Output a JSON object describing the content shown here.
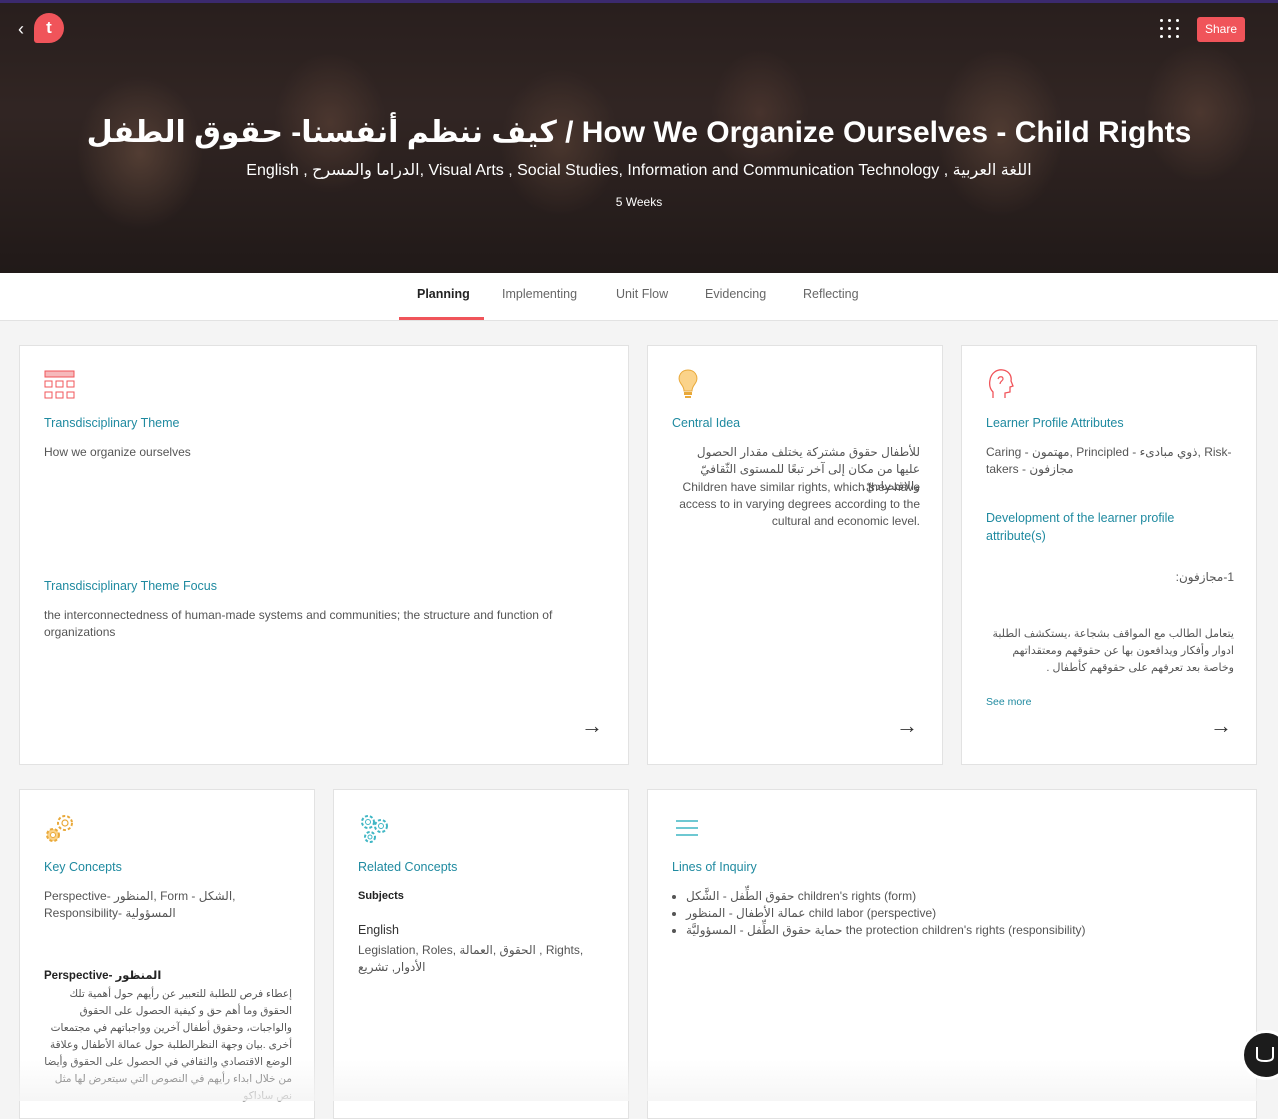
{
  "header": {
    "title": "كيف ننظم أنفسنا- حقوق الطفل / How We Organize Ourselves - Child Rights",
    "subjects": "English , الدراما والمسرح, Visual Arts , Social Studies, Information and Communication Technology , اللغة العربية",
    "duration": "5 Weeks",
    "logo_text": "t",
    "share_label": "Share",
    "back_icon": "‹"
  },
  "tabs": [
    {
      "label": "Planning",
      "active": true
    },
    {
      "label": "Implementing"
    },
    {
      "label": "Unit Flow"
    },
    {
      "label": "Evidencing"
    },
    {
      "label": "Reflecting"
    }
  ],
  "cards": {
    "theme": {
      "title": "Transdisciplinary Theme",
      "text": "How we organize ourselves",
      "focus_title": "Transdisciplinary Theme Focus",
      "focus_text": "the interconnectedness of human-made systems and communities; the structure and function of organizations"
    },
    "central_idea": {
      "title": "Central Idea",
      "text_ar": "للأطفال حقوق مشتركة يختلف مقدار الحصول عليها من مكان إلى آخر تبعًا للمستوى الثّقافيّ والاقتصاديّ.",
      "text_en": "Children have similar rights, which they have access to in varying degrees according to the cultural and economic level."
    },
    "learner_profile": {
      "title": "Learner Profile Attributes",
      "text": "Caring - مهتمون, Principled - ذوي مبادىء, Risk-takers - مجازفون",
      "dev_title": "Development of the learner profile attribute(s)",
      "dev_item": "1-مجازفون:",
      "dev_text": "يتعامل الطالب مع المواقف بشجاعة ،يستكشف الطلبة ادوار وأفكار ويدافعون بها عن حقوقهم ومعتقداتهم وخاصة بعد تعرفهم على حقوقهم كأطفال .",
      "see_more": "See more"
    },
    "key_concepts": {
      "title": "Key Concepts",
      "text": "Perspective- المنظور, Form - الشكل, Responsibility- المسؤولية",
      "perspective_label": "Perspective- المنظور",
      "perspective_text": "إعطاء فرص للطلبة للتعبير عن رأيهم حول أهمية تلك الحقوق وما أهم حق و كيفية الحصول على الحقوق والواجبات، وحقوق أطفال آخرين وواجباتهم في مجتمعات أخرى .بيان وجهة النظرالطلبة حول عمالة الأطفال وعلاقة الوضع الاقتصادي والثقافي في الحصول على الحقوق وأيضا من خلال ابداء رأيهم في النصوص التي سيتعرض لها مثل نص ساداكو"
    },
    "related_concepts": {
      "title": "Related Concepts",
      "subjects_label": "Subjects",
      "subject": "English",
      "text": "Legislation, Roles, الحقوق ,العمالة , Rights, الأدوار, تشريع"
    },
    "lines_of_inquiry": {
      "title": "Lines of Inquiry",
      "items": [
        "حقوق الطِّفل - الشَّكل children's rights (form)",
        "عمالة الأطفال - المنظور child labor (perspective)",
        "حماية حقوق الطِّفل - المسؤوليَّة the protection children's rights (responsibility)"
      ]
    }
  },
  "icons": {
    "grid": "grid-dots-icon",
    "theme": "calendar-grid-icon",
    "central_idea": "lightbulb-icon",
    "learner_profile": "head-profile-icon",
    "key_concepts": "gears-icon",
    "related_concepts": "gear-network-icon",
    "lines_of_inquiry": "lines-icon",
    "arrow": "arrow-right-icon",
    "chat": "chat-icon"
  },
  "colors": {
    "accent": "#f0545a",
    "title_teal": "#1f8aa0"
  }
}
